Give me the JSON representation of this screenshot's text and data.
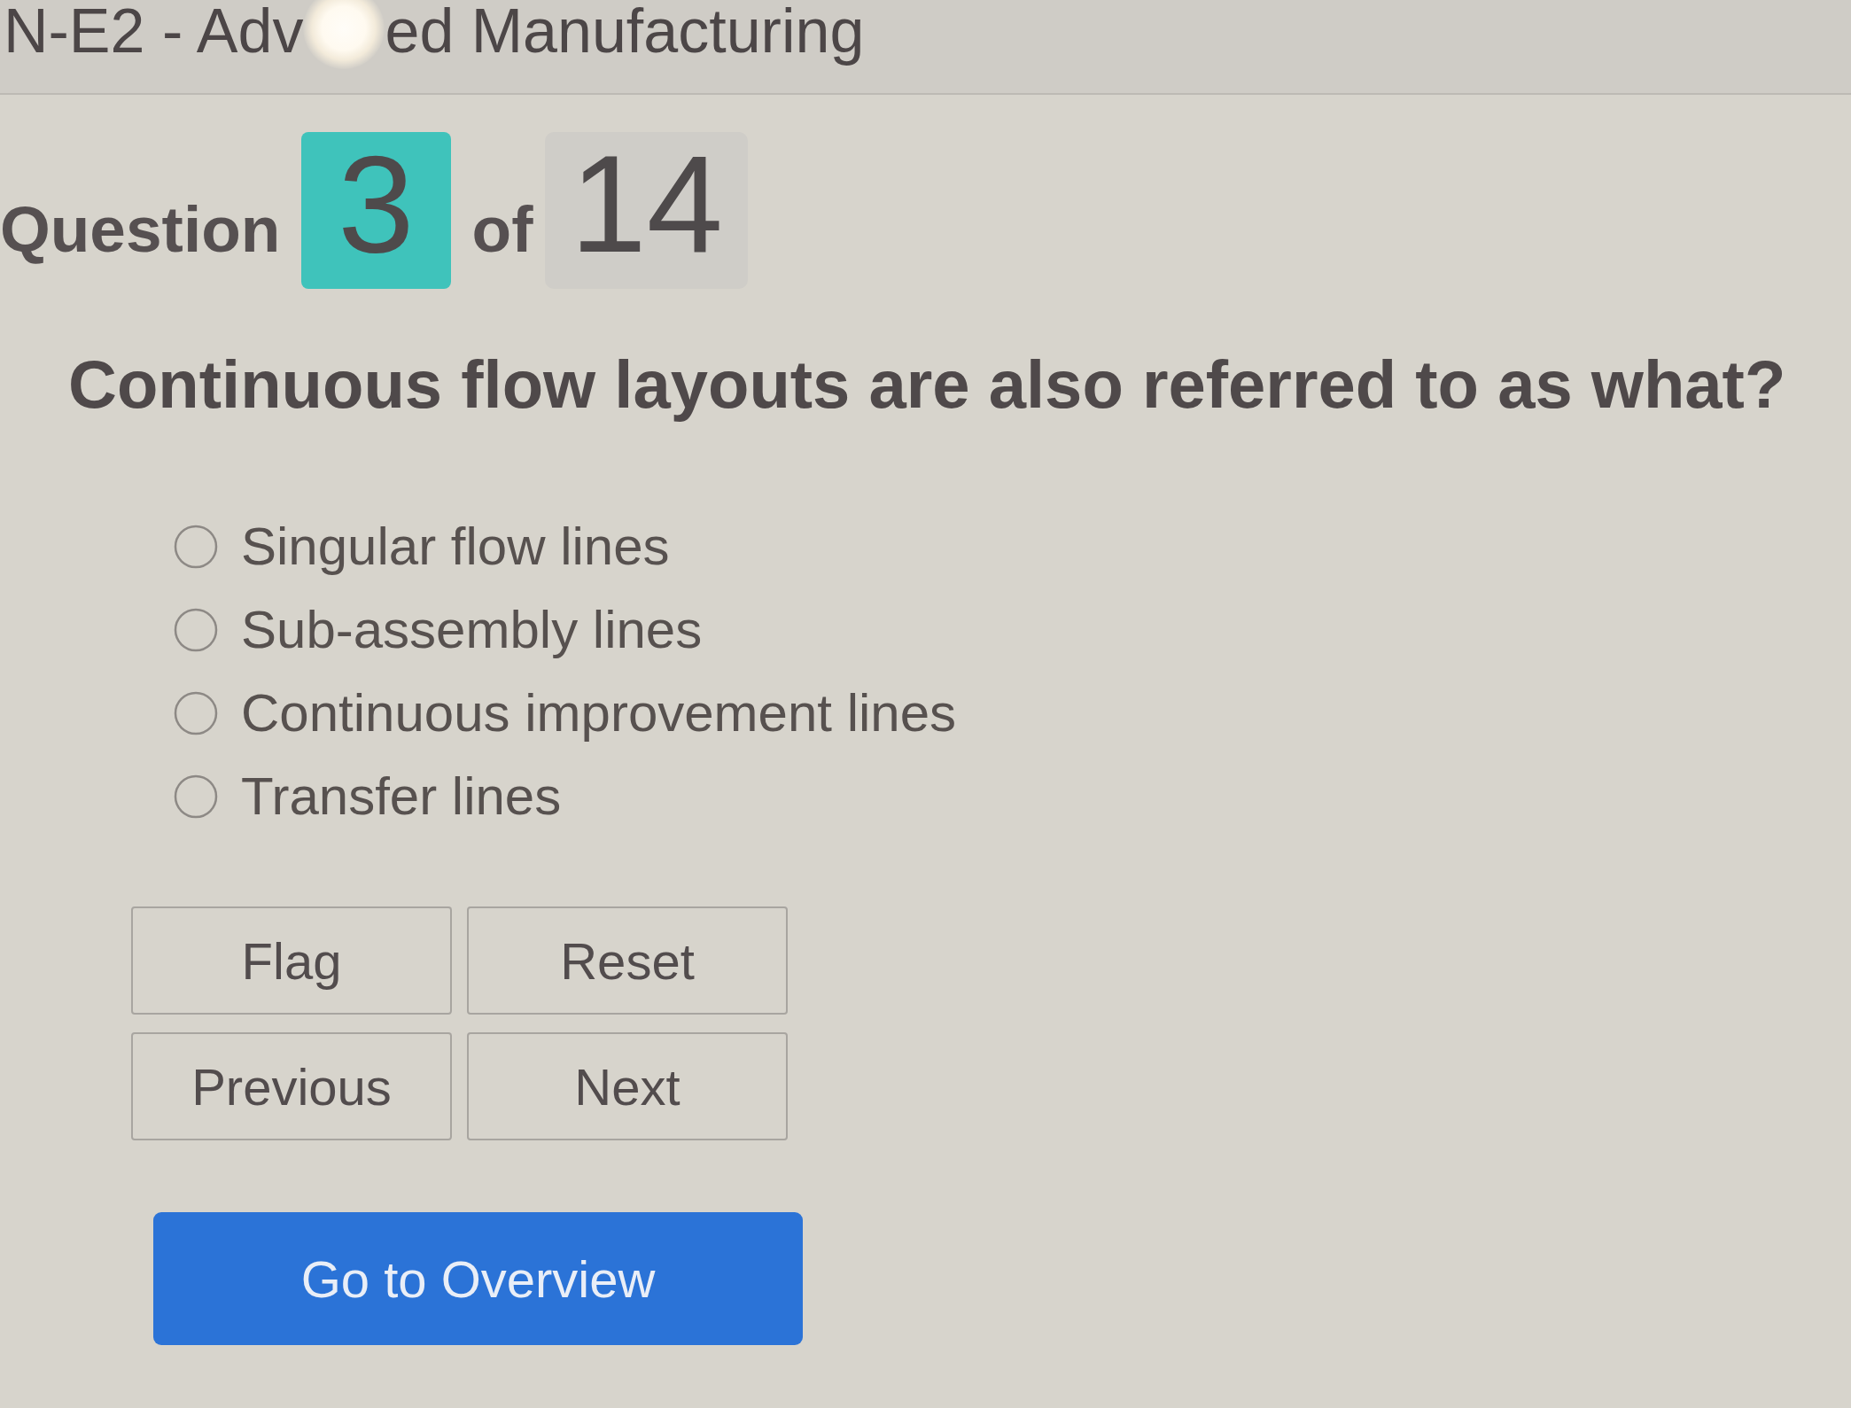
{
  "header": {
    "title_parts": [
      "N-E2 - Adv",
      "ed Manufacturing"
    ]
  },
  "progress": {
    "label": "Question",
    "current": "3",
    "separator": "of",
    "total": "14"
  },
  "question": {
    "text": "Continuous flow layouts are also referred to as what?"
  },
  "options": [
    {
      "label": "Singular flow lines",
      "selected": false
    },
    {
      "label": "Sub-assembly lines",
      "selected": false
    },
    {
      "label": "Continuous improvement lines",
      "selected": false
    },
    {
      "label": "Transfer lines",
      "selected": false
    }
  ],
  "buttons": [
    {
      "label": "Flag"
    },
    {
      "label": "Reset"
    },
    {
      "label": "Previous"
    },
    {
      "label": "Next"
    }
  ],
  "overview_button": {
    "label": "Go to Overview"
  }
}
